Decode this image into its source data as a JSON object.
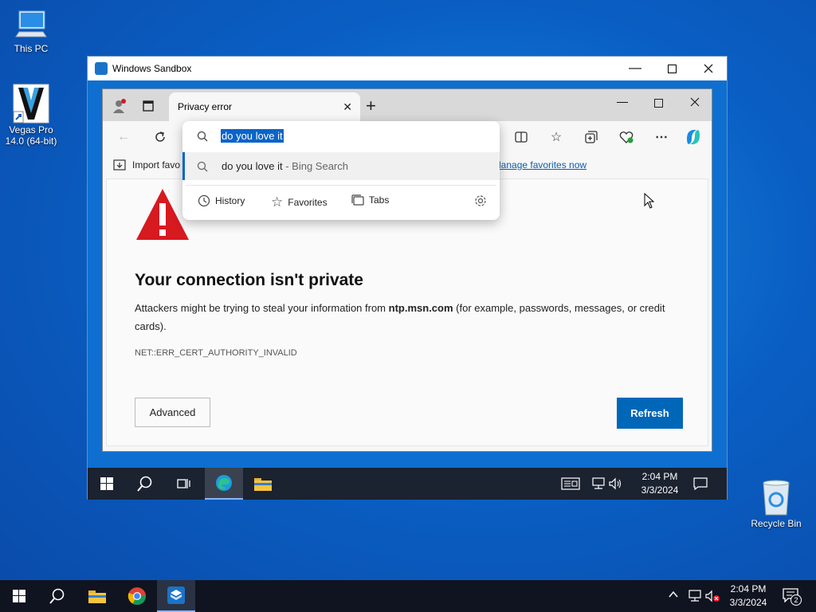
{
  "desktop": {
    "icons": [
      {
        "label": "This PC"
      },
      {
        "label": "Vegas Pro 14.0 (64-bit)"
      },
      {
        "label": "Recycle Bin"
      }
    ]
  },
  "sandbox": {
    "title": "Windows Sandbox"
  },
  "edge": {
    "tab_title": "Privacy error",
    "favorites_bar": {
      "import_label": "Import favo",
      "manage_label": "lanage favorites now"
    },
    "omnibox": {
      "query": "do you love it",
      "suggestion_query": "do you love it",
      "suggestion_source": " - Bing Search",
      "footer": {
        "history": "History",
        "favorites": "Favorites",
        "tabs": "Tabs"
      }
    },
    "error_page": {
      "heading": "Your connection isn't private",
      "description_pre": "Attackers might be trying to steal your information from ",
      "domain": "ntp.msn.com",
      "description_post": " (for example, passwords, messages, or credit cards).",
      "error_code": "NET::ERR_CERT_AUTHORITY_INVALID",
      "advanced_label": "Advanced",
      "refresh_label": "Refresh"
    }
  },
  "inner_taskbar": {
    "time": "2:04 PM",
    "date": "3/3/2024"
  },
  "taskbar": {
    "time": "2:04 PM",
    "date": "3/3/2024",
    "notification_count": "2"
  },
  "colors": {
    "accent": "#0067b8",
    "warning_red": "#d71920"
  }
}
